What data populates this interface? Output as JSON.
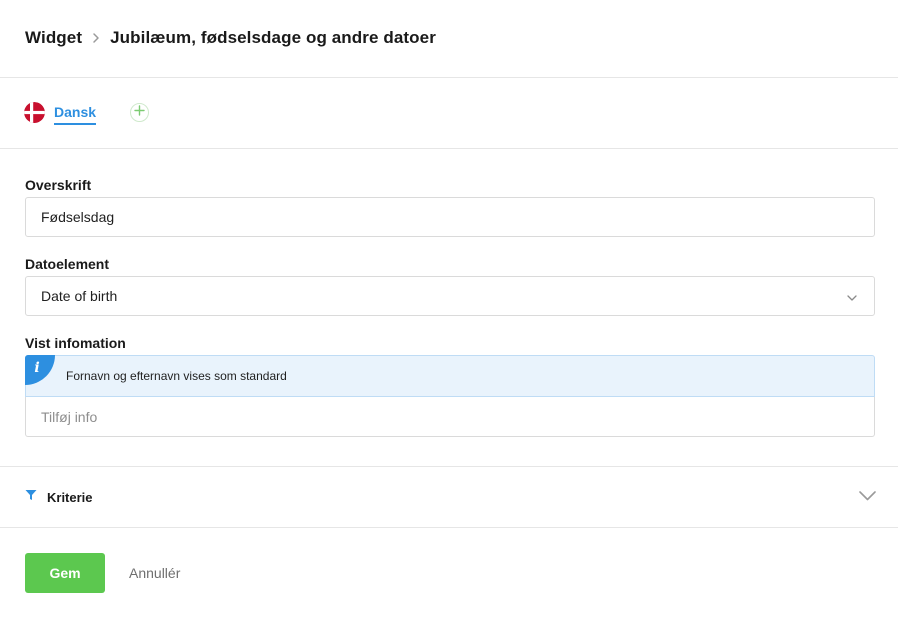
{
  "breadcrumb": {
    "root": "Widget",
    "current": "Jubilæum, fødselsdage og andre datoer"
  },
  "languages": {
    "active_label": "Dansk",
    "flag_icon": "denmark-flag-icon",
    "add_icon": "plus-icon"
  },
  "form": {
    "heading_label": "Overskrift",
    "heading_value": "Fødselsdag",
    "date_element_label": "Datoelement",
    "date_element_value": "Date of birth",
    "shown_info_label": "Vist infomation",
    "info_text": "Fornavn og efternavn vises som standard",
    "add_info_placeholder": "Tilføj info"
  },
  "criteria": {
    "label": "Kriterie"
  },
  "actions": {
    "save_label": "Gem",
    "cancel_label": "Annullér"
  },
  "colors": {
    "accent_blue": "#2d8fe0",
    "save_green": "#5cc84f",
    "info_bg": "#e9f3fc",
    "flag_red": "#c8102e"
  }
}
